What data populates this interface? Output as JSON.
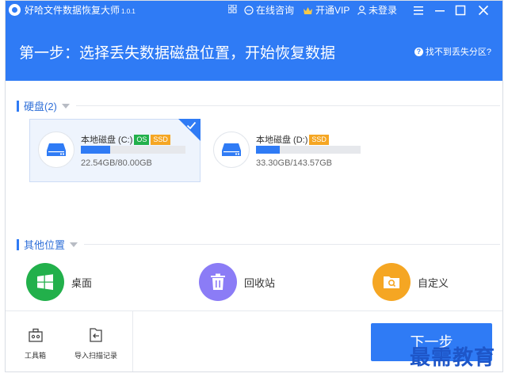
{
  "app": {
    "title": "好哈文件数据恢复大师",
    "version": "1.0.1"
  },
  "titlebar": {
    "consult": "在线咨询",
    "vip": "开通VIP",
    "login": "未登录"
  },
  "header": {
    "title": "第一步：选择丢失数据磁盘位置，开始恢复数据",
    "help": "找不到丢失分区?"
  },
  "disks_section": {
    "label": "硬盘(2)"
  },
  "disks": [
    {
      "name": "本地磁盘 (C:)",
      "tags": [
        "OS",
        "SSD"
      ],
      "size": "22.54GB/80.00GB",
      "usage": 0.28,
      "selected": true
    },
    {
      "name": "本地磁盘 (D:)",
      "tags": [
        "SSD"
      ],
      "size": "33.30GB/143.57GB",
      "usage": 0.23,
      "selected": false
    }
  ],
  "other_section": {
    "label": "其他位置"
  },
  "locations": [
    {
      "label": "桌面",
      "icon": "windows-icon",
      "color": "#22b04b"
    },
    {
      "label": "回收站",
      "icon": "trash-icon",
      "color": "#8b7cf6"
    },
    {
      "label": "自定义",
      "icon": "folder-search-icon",
      "color": "#f5a623"
    }
  ],
  "footer": {
    "toolbox": "工具箱",
    "import": "导入扫描记录",
    "next": "下一步"
  },
  "watermark": "最需教育",
  "colors": {
    "primary": "#2f7bf5",
    "os_tag": "#22b04b",
    "ssd_tag": "#f5a623"
  }
}
